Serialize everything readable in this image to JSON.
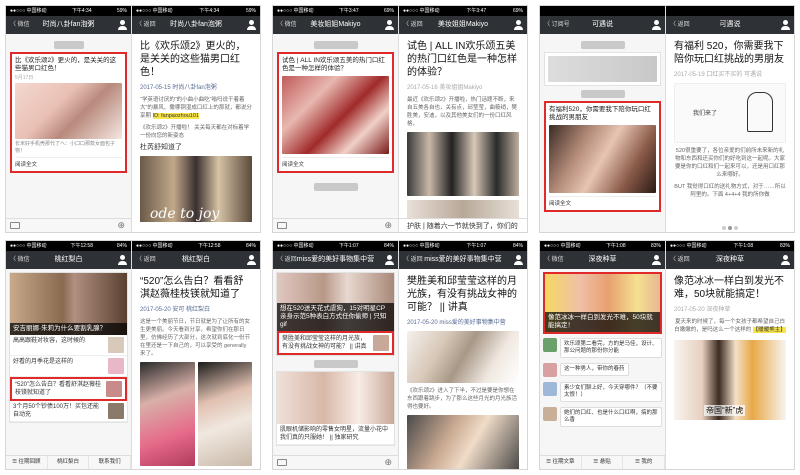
{
  "status": {
    "p1": {
      "carrier": "●●○○○ 中国移动",
      "time": "下午4:34",
      "battery": "59%"
    },
    "p2": {
      "carrier": "●●○○○ 中国移动",
      "time": "下午3:47",
      "battery": "69%"
    },
    "p3": {
      "carrier": "",
      "time": "",
      "battery": ""
    },
    "p4": {
      "carrier": "●●○○○ 中国移动",
      "time": "下午12:58",
      "battery": "84%"
    },
    "p5": {
      "carrier": "●●○○○ 中国移动",
      "time": "下午1:07",
      "battery": "84%"
    },
    "p6": {
      "carrier": "●●○○○ 中国移动",
      "time": "下午1:08",
      "battery": "83%"
    }
  },
  "panels": [
    {
      "left": {
        "back": "〈 微信",
        "title": "时尚八卦fan泡粥",
        "card": {
          "title": "比《欢乐颂2》更火的，是关关的这些猫男口红色！",
          "date": "5月17日",
          "desc": "长米好手机壳那代了ヘ：小口口那款女面包子物！",
          "read": "阅读全文"
        }
      },
      "right": {
        "back": "〈 返回",
        "title": "时尚八卦fan泡粥",
        "atitle": "比《欢乐颂2》更火的，是关关的这些猫男口红色！",
        "meta": "2017-05-15 时尚八卦fan泡粥",
        "para1": "“学英语讨厌的”的小曲小曲吃“嗡吗说干着着大”的暴风、撒哪铜湿成口红上的那就，都说分享期",
        "para1_hl": "ID: fanpaozhou101",
        "para2": "《欢乐颂2》开播啦！ 关关每天都在对标着学一份向您的新姿态",
        "link": "杜芮舒知道了",
        "caption": "ode to joy"
      }
    },
    {
      "left": {
        "back": "〈 微信",
        "title": "美妆姐姐Makiyo",
        "card": {
          "title": "试色 | ALL IN欢乐颂五美的热门口红色是一种怎样的体验？",
          "date": "",
          "desc": "",
          "read": "阅读全文"
        }
      },
      "right": {
        "back": "〈 返回",
        "title": "美妆姐姐Makiyo",
        "atitle": "试色 | ALL IN欢乐颂五美的热门口红色是一种怎样的体验？",
        "meta": "2017-05-16 美妆姐姐Makiyo",
        "para1": "最近《欢乐颂2》开播啦，热门话题不断，来自五美各自也，关有点，邱莹莹，曲筱绡，樊胜美，安迪，以及其他美女们的一份口红风格，",
        "footer": "护肤 | 随着六一节就快到了，你们的"
      }
    },
    {
      "left": {
        "back": "〈 订阅号",
        "title": "可遇说",
        "card": {
          "title": "有福利520，你需要我下陪你玩口红挑战的男朋友",
          "date": "",
          "desc": "",
          "read": "阅读全文"
        }
      },
      "right": {
        "back": "〈 返回",
        "title": "可遇说",
        "atitle": "有福利 520，你需要我下陪你玩口红挑战的男朋友",
        "meta": "2017-05-19 口红买不买的 可遇说",
        "sign": "我们来了",
        "para1": "520很重要了，各位亲爱的们前所未来新的礼物和东西和还买你们的好吃到这一起呢。大家要是你的口红和们一起来可以，还是用口红那么来哪好。",
        "para2": "BUT 我觉得口红的送礼物方式，对于……所以阿里的。下面 4+4+4 我的所你做"
      }
    },
    {
      "left": {
        "back": "〈 微信",
        "title": "桃红梨白",
        "items": [
          {
            "title": "安吉丽娜·朱莉为什么要割乳腺？"
          },
          {
            "title": "高高跟鞋对妆容，这时候的"
          },
          {
            "title": "好看的月季花是这样的"
          },
          {
            "title": "“520”怎么告白？看看舒淇赵薇桂枝镁就知道了"
          },
          {
            "title": "3个月50个钞债100万！买包还能自动充"
          }
        ],
        "tabs": [
          "☰ 往期回顾",
          "桃红梨白",
          "联系我们"
        ]
      },
      "right": {
        "back": "〈 返回",
        "title": "桃红梨白",
        "atitle": "“520”怎么告白？看看舒淇赵薇桂枝镁就知道了",
        "meta": "2017-05-20 安可 桃红梨白",
        "para1": "这是一个美丽节日，节日就是为了让所有的女生更美丽。今天看到分享，希望你们在那日里，仿佛经历了大部分，这次就到底化一份节在里还是一下自己的，可以享受的 generally 来了。"
      }
    },
    {
      "left": {
        "back": "〈 返回",
        "title": "miss爱的美好事物集中营",
        "items": [
          {
            "title": "想在520送天花式虐狗，15对明星CP亲身示范5种表白方式任你偷师 | 只知gif"
          },
          {
            "title": "樊胜美和邱莹莹这样的月光族，有没有挑战女神的可能？ || 讲真"
          },
          {
            "title": "肌眼机储影响的零售女明星，流量小花中我们真的只服她！ || 独家研究"
          }
        ]
      },
      "right": {
        "back": "〈 返回",
        "title": "miss爱的美好事物集中营",
        "atitle": "樊胜美和邱莹莹这样的月光族，有没有挑战女神的可能？ || 讲真",
        "meta": "2017-05-20 miss爱的美好事物集中营",
        "para1": "《欢乐颂2》进入了下半，不过是要是你想在东西跟着跳步，为了那么这些月光的月光族活得也要好。"
      }
    },
    {
      "left": {
        "back": "〈 微信",
        "title": "深夜种草",
        "card": {
          "overlay": "像范冰冰一样白到发光不难，50块就能搞定！",
          "date": "",
          "desc": "",
          "read": ""
        },
        "chats": [
          {
            "text": "欢乐颂第二看完，方的是马佳，设计、那公问题的那份你分能"
          },
          {
            "text": "这一种男人，带你的春药"
          },
          {
            "text": "素少女们聊上好，今天穿哪件？（不要太恨！）"
          },
          {
            "text": "她们的口红、也是什么口红啊，搞的那么香"
          }
        ],
        "tabs": [
          "☰ 往期文章",
          "☰ 悬贴",
          "☰ 我的"
        ]
      },
      "right": {
        "back": "〈 返回",
        "title": "深夜种草",
        "atitle": "像范冰冰一样白到发光不难，50块就能搞定！",
        "meta": "2017-05-20 深夜种草",
        "para1": "夏天来的时候了，每一个女孩子都希望自己白白嫩嫩的，是吗这么一个这样的",
        "para1_hl": "【暖暖熊主】",
        "caption": "帝国“新”虎"
      }
    }
  ],
  "colors": {
    "highlight_border": "#e0292b",
    "navbar": "#2e3135",
    "link": "#576b95",
    "text_highlight": "#f7e34a"
  }
}
